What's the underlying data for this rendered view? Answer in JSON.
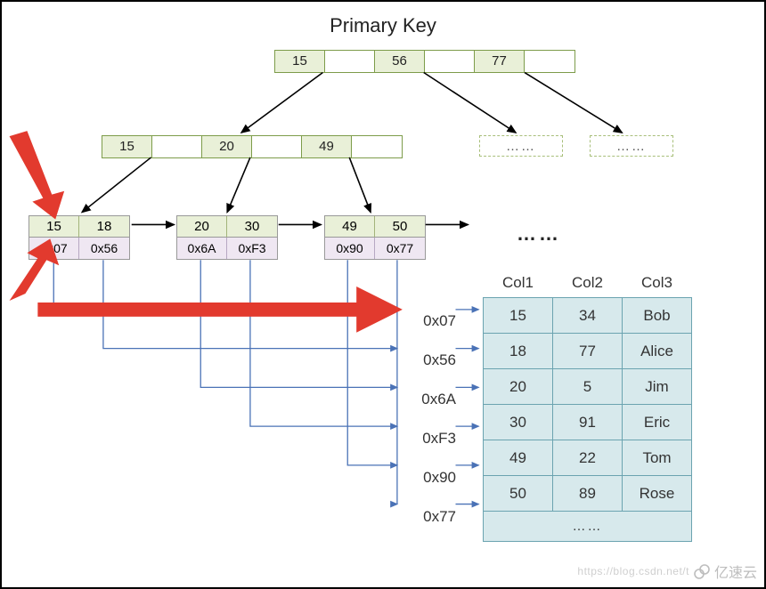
{
  "title": "Primary Key",
  "root": {
    "cells": [
      "15",
      "",
      "56",
      "",
      "77",
      ""
    ],
    "filled": [
      true,
      false,
      true,
      false,
      true,
      false
    ]
  },
  "mid": {
    "cells": [
      "15",
      "",
      "20",
      "",
      "49",
      ""
    ],
    "filled": [
      true,
      false,
      true,
      false,
      true,
      false
    ]
  },
  "ghosts": [
    "……",
    "……"
  ],
  "leaves": [
    {
      "keys": [
        "15",
        "18"
      ],
      "ptrs": [
        "0x07",
        "0x56"
      ]
    },
    {
      "keys": [
        "20",
        "30"
      ],
      "ptrs": [
        "0x6A",
        "0xF3"
      ]
    },
    {
      "keys": [
        "49",
        "50"
      ],
      "ptrs": [
        "0x90",
        "0x77"
      ]
    }
  ],
  "leaf_ellipsis": "……",
  "pointer_labels": [
    "0x07",
    "0x56",
    "0x6A",
    "0xF3",
    "0x90",
    "0x77"
  ],
  "table": {
    "headers": [
      "Col1",
      "Col2",
      "Col3"
    ],
    "rows": [
      [
        "15",
        "34",
        "Bob"
      ],
      [
        "18",
        "77",
        "Alice"
      ],
      [
        "20",
        "5",
        "Jim"
      ],
      [
        "30",
        "91",
        "Eric"
      ],
      [
        "49",
        "22",
        "Tom"
      ],
      [
        "50",
        "89",
        "Rose"
      ]
    ],
    "ellipsis": "……"
  },
  "watermark": {
    "brand": "亿速云",
    "faded": "https://blog.csdn.net/t"
  },
  "chart_data": {
    "type": "diagram",
    "concept": "B+Tree clustered (primary key) index pointing to table rows",
    "root_keys": [
      15,
      56,
      77
    ],
    "internal_level_keys": [
      15,
      20,
      49
    ],
    "leaf_entries": [
      {
        "key": 15,
        "row_pointer": "0x07"
      },
      {
        "key": 18,
        "row_pointer": "0x56"
      },
      {
        "key": 20,
        "row_pointer": "0x6A"
      },
      {
        "key": 30,
        "row_pointer": "0xF3"
      },
      {
        "key": 49,
        "row_pointer": "0x90"
      },
      {
        "key": 50,
        "row_pointer": "0x77"
      }
    ],
    "table_rows": [
      {
        "Col1": 15,
        "Col2": 34,
        "Col3": "Bob"
      },
      {
        "Col1": 18,
        "Col2": 77,
        "Col3": "Alice"
      },
      {
        "Col1": 20,
        "Col2": 5,
        "Col3": "Jim"
      },
      {
        "Col1": 30,
        "Col2": 91,
        "Col3": "Eric"
      },
      {
        "Col1": 49,
        "Col2": 22,
        "Col3": "Tom"
      },
      {
        "Col1": 50,
        "Col2": 89,
        "Col3": "Rose"
      }
    ],
    "highlight": {
      "lookup_key": 15,
      "lookup_pointer": "0x07"
    }
  }
}
